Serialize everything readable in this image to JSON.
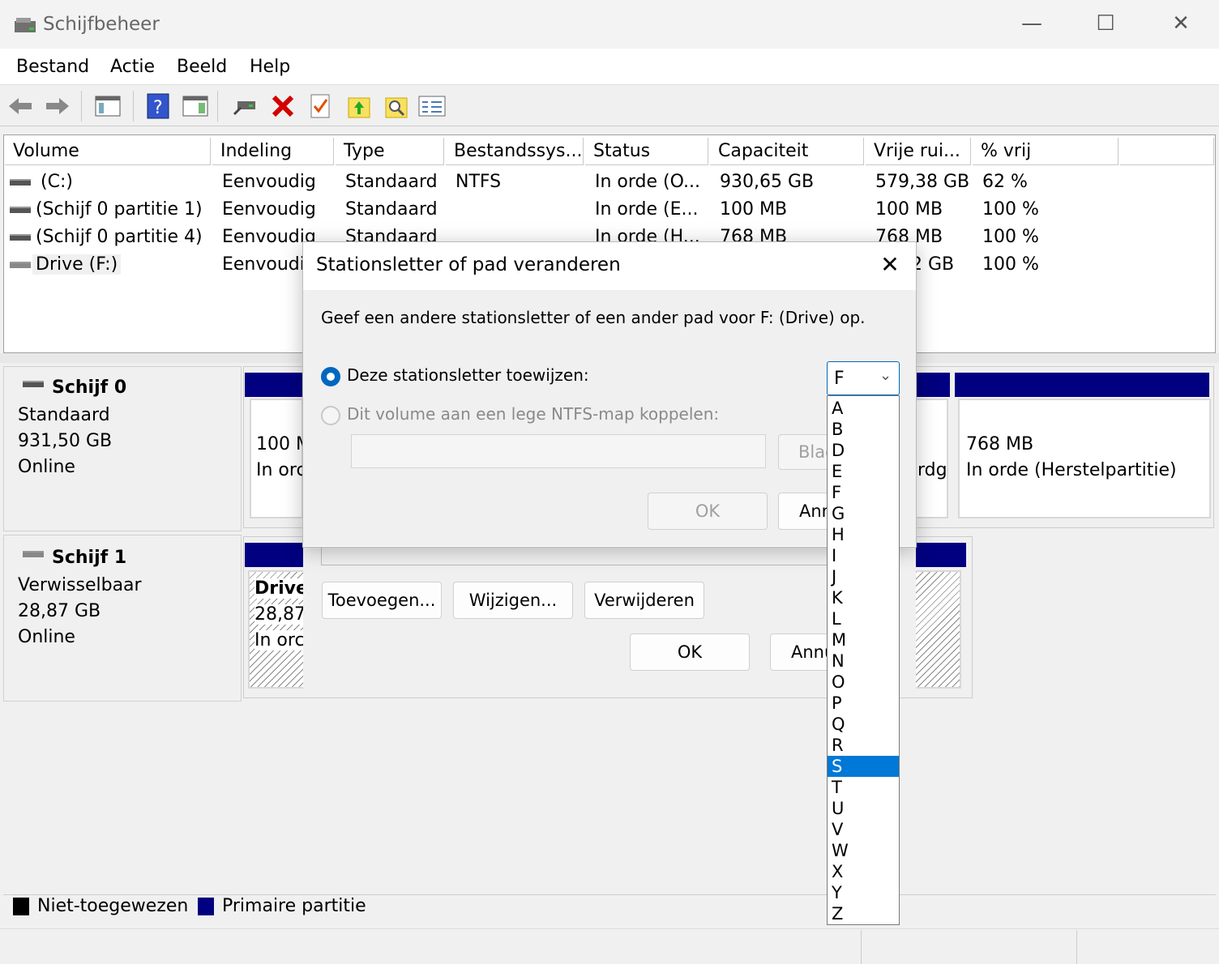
{
  "window": {
    "title": "Schijfbeheer",
    "icon": "disk-management-icon",
    "minimize": "—",
    "maximize": "☐",
    "close": "✕"
  },
  "menu": [
    "Bestand",
    "Actie",
    "Beeld",
    "Help"
  ],
  "toolbar": {
    "icons": [
      "back-arrow-icon",
      "forward-arrow-icon",
      "console-tree-icon",
      "help-icon",
      "details-pane-icon",
      "connect-drive-icon",
      "delete-icon",
      "checklist-icon",
      "upload-folder-icon",
      "search-folder-icon",
      "properties-list-icon"
    ]
  },
  "volumes": {
    "columns": [
      "Volume",
      "Indeling",
      "Type",
      "Bestandssys...",
      "Status",
      "Capaciteit",
      "Vrije rui...",
      "% vrij"
    ],
    "rows": [
      [
        "(C:)",
        "Eenvoudig",
        "Standaard",
        "NTFS",
        "In orde (O...",
        "930,65 GB",
        "579,38 GB",
        "62 %"
      ],
      [
        "(Schijf 0 partitie 1)",
        "Eenvoudig",
        "Standaard",
        "",
        "In orde (E...",
        "100 MB",
        "100 MB",
        "100 %"
      ],
      [
        "(Schijf 0 partitie 4)",
        "Eenvoudig",
        "Standaard",
        "",
        "In orde (H...",
        "768 MB",
        "768 MB",
        "100 %"
      ],
      [
        "Drive (F:)",
        "Eenvoudi",
        "",
        "",
        "",
        "",
        "2 GB",
        "100 %"
      ]
    ]
  },
  "disks": [
    {
      "name": "Schijf 0",
      "type": "Standaard",
      "size": "931,50 GB",
      "state": "Online",
      "parts": {
        "p1_size": "100 M",
        "p1_state": "In orc",
        "p2_state": "rdg",
        "p4_size": "768 MB",
        "p4_state": "In orde (Herstelpartitie)"
      }
    },
    {
      "name": "Schijf 1",
      "type": "Verwisselbaar",
      "size": "28,87 GB",
      "state": "Online",
      "parts": {
        "name": "Drive",
        "size": "28,87",
        "state": "In orc"
      }
    }
  ],
  "legend": {
    "unallocated": "Niet-toegewezen",
    "primary": "Primaire partitie"
  },
  "props_dialog": {
    "add": "Toevoegen...",
    "change": "Wijzigen...",
    "remove": "Verwijderen",
    "ok": "OK",
    "cancel": "Annu"
  },
  "dialog": {
    "title": "Stationsletter of pad veranderen",
    "close": "✕",
    "instruction": "Geef een andere stationsletter of een ander pad voor F: (Drive) op.",
    "radio_assign": "Deze stationsletter toewijzen:",
    "radio_mount": "Dit volume aan een lege NTFS-map koppelen:",
    "path_value": "",
    "browse": "Blad",
    "ok": "OK",
    "cancel": "Ann",
    "selected_letter": "F",
    "highlighted_option": "S",
    "options": [
      "A",
      "B",
      "D",
      "E",
      "F",
      "G",
      "H",
      "I",
      "J",
      "K",
      "L",
      "M",
      "N",
      "O",
      "P",
      "Q",
      "R",
      "S",
      "T",
      "U",
      "V",
      "W",
      "X",
      "Y",
      "Z"
    ]
  },
  "colors": {
    "primary_partition": "#000080",
    "unallocated": "#000000",
    "selection": "#0078d7",
    "radio_accent": "#0067c0",
    "close_red": "#d40000"
  }
}
